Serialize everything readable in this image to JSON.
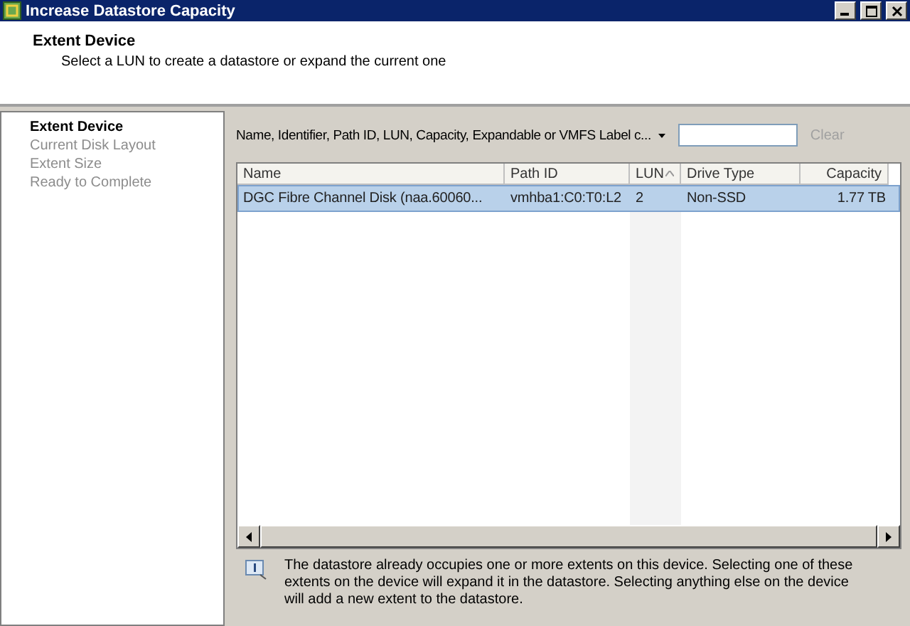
{
  "window": {
    "title": "Increase Datastore Capacity"
  },
  "header": {
    "title": "Extent Device",
    "subtitle": "Select a LUN to create a datastore or expand the current one"
  },
  "steps": [
    {
      "label": "Extent Device",
      "selected": true
    },
    {
      "label": "Current Disk Layout",
      "selected": false
    },
    {
      "label": "Extent Size",
      "selected": false
    },
    {
      "label": "Ready to Complete",
      "selected": false
    }
  ],
  "filter": {
    "label": "Name, Identifier, Path ID, LUN, Capacity, Expandable or VMFS Label c...",
    "button": "Clear"
  },
  "table": {
    "columns": [
      {
        "label": "Name",
        "sorted": false
      },
      {
        "label": "Path ID",
        "sorted": false
      },
      {
        "label": "LUN",
        "sorted": true
      },
      {
        "label": "Drive Type",
        "sorted": false
      },
      {
        "label": "Capacity",
        "sorted": false
      }
    ],
    "rows": [
      {
        "selected": true,
        "cells": [
          "DGC Fibre Channel Disk (naa.60060...",
          "vmhba1:C0:T0:L2",
          "2",
          "Non-SSD",
          "1.77 TB"
        ]
      }
    ]
  },
  "info": "The datastore already occupies one or more extents on this device. Selecting one of these extents on the device will expand it in the datastore. Selecting anything else on the device will add a new extent to the datastore."
}
